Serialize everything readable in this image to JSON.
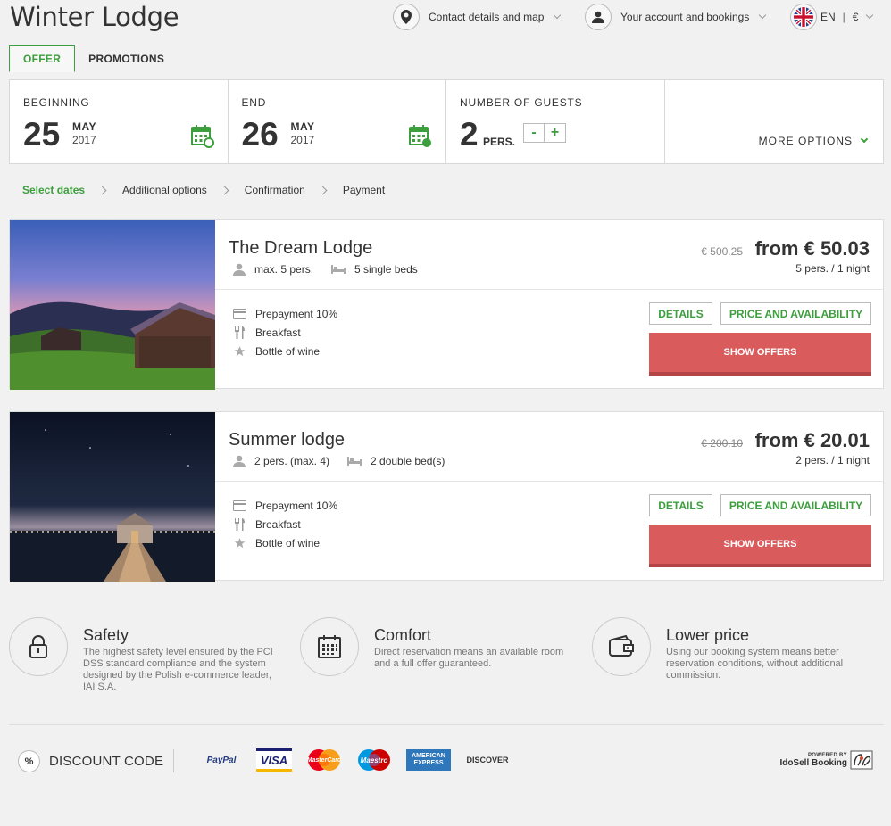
{
  "header": {
    "brand": "Winter Lodge",
    "contact_label": "Contact details and map",
    "account_label": "Your account and bookings",
    "language": "EN",
    "currency_sep": "|",
    "currency": "€"
  },
  "tabs": [
    {
      "label": "OFFER",
      "active": true
    },
    {
      "label": "PROMOTIONS",
      "active": false
    }
  ],
  "search": {
    "beginning_label": "BEGINNING",
    "beginning_day": "25",
    "beginning_month": "MAY",
    "beginning_year": "2017",
    "end_label": "END",
    "end_day": "26",
    "end_month": "MAY",
    "end_year": "2017",
    "guests_label": "NUMBER OF GUESTS",
    "guests_count": "2",
    "guests_unit": "PERS.",
    "minus": "-",
    "plus": "+",
    "more_options": "MORE OPTIONS"
  },
  "steps": [
    "Select dates",
    "Additional options",
    "Confirmation",
    "Payment"
  ],
  "offers": [
    {
      "title": "The Dream Lodge",
      "capacity": "max. 5 pers.",
      "beds": "5 single beds",
      "old_price": "€ 500.25",
      "price": "from € 50.03",
      "per": "5 pers. / 1 night",
      "inclusions": [
        "Prepayment 10%",
        "Breakfast",
        "Bottle of wine"
      ],
      "details_label": "DETAILS",
      "price_label": "PRICE AND AVAILABILITY",
      "show_label": "SHOW OFFERS"
    },
    {
      "title": "Summer lodge",
      "capacity": "2 pers. (max. 4)",
      "beds": "2 double bed(s)",
      "old_price": "€ 200.10",
      "price": "from € 20.01",
      "per": "2 pers. / 1 night",
      "inclusions": [
        "Prepayment 10%",
        "Breakfast",
        "Bottle of wine"
      ],
      "details_label": "DETAILS",
      "price_label": "PRICE AND AVAILABILITY",
      "show_label": "SHOW OFFERS"
    }
  ],
  "features": [
    {
      "icon": "lock-icon",
      "title": "Safety",
      "lines": [
        "The highest safety level ensured by the PCI",
        "DSS standard compliance and the system",
        "designed by the Polish e-commerce leader,",
        "IAI S.A."
      ]
    },
    {
      "icon": "calendar-icon",
      "title": "Comfort",
      "lines": [
        "Direct reservation means an available room",
        "and a full offer guaranteed."
      ]
    },
    {
      "icon": "wallet-icon",
      "title": "Lower price",
      "lines": [
        "Using our booking system means better",
        "reservation conditions, without additional",
        "commission."
      ]
    }
  ],
  "footer": {
    "discount_symbol": "%",
    "discount_label": "DISCOUNT CODE",
    "payments": [
      "PayPal",
      "VISA",
      "MasterCard",
      "Maestro",
      "AMERICAN EXPRESS",
      "DISCOVER"
    ],
    "powered_small": "POWERED BY",
    "powered_name": "IdoSell Booking"
  },
  "colors": {
    "accent_green": "#3d9e3d",
    "button_red": "#d95b5b"
  }
}
